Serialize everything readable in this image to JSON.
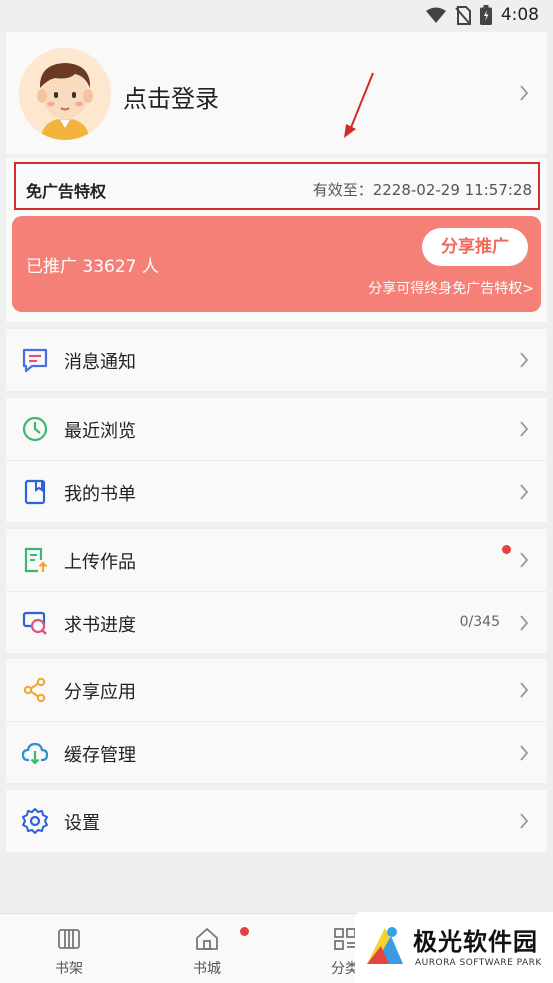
{
  "status_bar": {
    "time": "4:08",
    "icons": [
      "wifi-icon",
      "no-sim-icon",
      "battery-icon"
    ]
  },
  "profile": {
    "login_text": "点击登录"
  },
  "ad_free": {
    "title": "免广告特权",
    "expiry": "有效至：2228-02-29 11:57:28"
  },
  "promo": {
    "count_text": "已推广 33627 人",
    "share_button": "分享推广",
    "hint": "分享可得终身免广告特权>"
  },
  "menu": {
    "messages": "消息通知",
    "recent": "最近浏览",
    "booklist": "我的书单",
    "upload": "上传作品",
    "request": "求书进度",
    "request_value": "0/345",
    "share_app": "分享应用",
    "cache": "缓存管理",
    "settings": "设置"
  },
  "bottom_nav": {
    "tabs": [
      "书架",
      "书城",
      "分类"
    ]
  },
  "watermark": {
    "title": "极光软件园",
    "subtitle": "AURORA SOFTWARE PARK"
  },
  "colors": {
    "accent": "#f58077",
    "share_text": "#f06b5e",
    "highlight_box": "#d22b2b",
    "dot": "#e84040"
  }
}
